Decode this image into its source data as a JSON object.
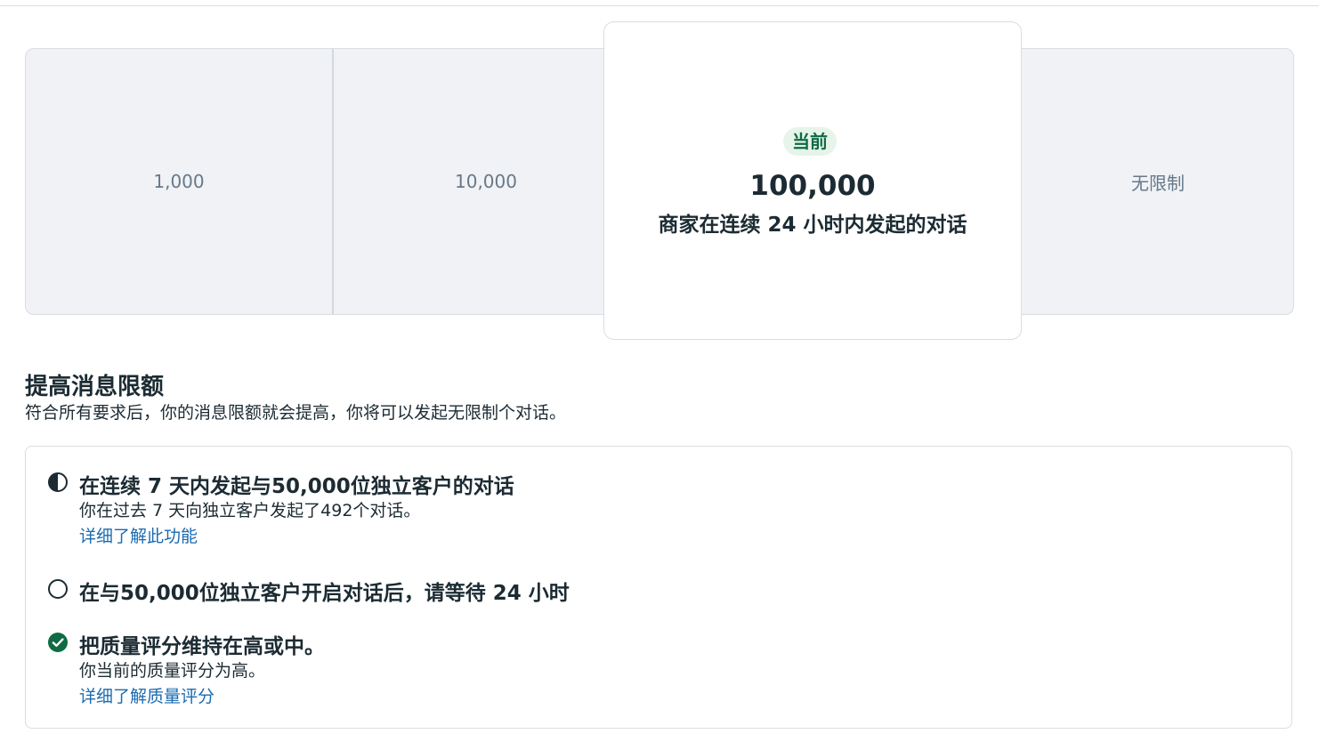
{
  "tiers": {
    "items": [
      "1,000",
      "10,000",
      "100,000",
      "无限制"
    ],
    "current": {
      "badge": "当前",
      "value": "100,000",
      "description": "商家在连续 24 小时内发起的对话"
    }
  },
  "section": {
    "title": "提高消息限额",
    "subtitle": "符合所有要求后，你的消息限额就会提高，你将可以发起无限制个对话。"
  },
  "requirements": [
    {
      "status": "in-progress",
      "icon": "half-circle-icon",
      "title": "在连续 7 天内发起与50,000位独立客户的对话",
      "subtitle": "你在过去 7 天向独立客户发起了492个对话。",
      "link": "详细了解此功能"
    },
    {
      "status": "pending",
      "icon": "empty-circle-icon",
      "title": "在与50,000位独立客户开启对话后，请等待 24 小时"
    },
    {
      "status": "complete",
      "icon": "check-circle-icon",
      "title": "把质量评分维持在高或中。",
      "subtitle": "你当前的质量评分为高。",
      "link": "详细了解质量评分"
    }
  ],
  "colors": {
    "accent_green": "#0f6b43",
    "link_blue": "#1a6bb0",
    "strip_bg": "#f0f2f5"
  }
}
